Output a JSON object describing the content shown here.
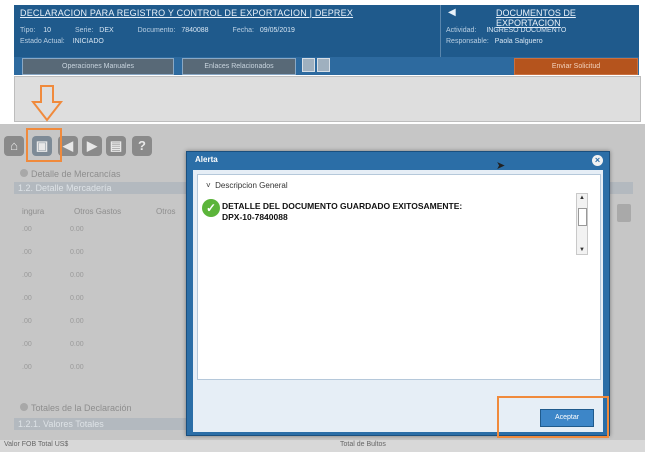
{
  "header": {
    "title": "DECLARACION PARA REGISTRO Y CONTROL DE EXPORTACION | DEPREX",
    "right_title": "DOCUMENTOS DE EXPORTACION",
    "tipo_label": "Tipo:",
    "tipo_value": "10",
    "serie_label": "Serie:",
    "serie_value": "DEX",
    "documento_label": "Documento:",
    "documento_value": "7840088",
    "fecha_label": "Fecha:",
    "fecha_value": "09/05/2019",
    "estado_label": "Estado Actual:",
    "estado_value": "INICIADO",
    "actividad_label": "Actividad:",
    "actividad_value": "INGRESO DOCUMENTO",
    "responsable_label": "Responsable:",
    "responsable_value": "Paola Salguero"
  },
  "buttons": {
    "operaciones": "Operaciones Manuales",
    "enlaces": "Enlaces Relacionados",
    "enviar": "Enviar Solicitud"
  },
  "sections": {
    "detalle": "Detalle de Mercancías",
    "detalle_sub": "1.2. Detalle Mercadería",
    "col1": "ingura",
    "col2": "Otros Gastos",
    "col3": "Otros",
    "totales": "Totales de la Declaración",
    "totales_sub": "1.2.1. Valores Totales",
    "fob_label": "Valor FOB Total US$",
    "bultos_label": "Total de Bultos"
  },
  "grid_rows": [
    {
      "a": ".00",
      "b": "0.00"
    },
    {
      "a": ".00",
      "b": "0.00"
    },
    {
      "a": ".00",
      "b": "0.00"
    },
    {
      "a": ".00",
      "b": "0.00"
    },
    {
      "a": ".00",
      "b": "0.00"
    },
    {
      "a": ".00",
      "b": "0.00"
    },
    {
      "a": ".00",
      "b": "0.00"
    }
  ],
  "dialog": {
    "title": "Alerta",
    "section": "Descripcion General",
    "message_line1": "DETALLE DEL DOCUMENTO GUARDADO EXITOSAMENTE:",
    "message_line2": "DPX-10-7840088",
    "accept": "Aceptar"
  },
  "colors": {
    "header_bg": "#1f5a8c",
    "highlight": "#f08a3c",
    "success": "#5bb43a"
  }
}
